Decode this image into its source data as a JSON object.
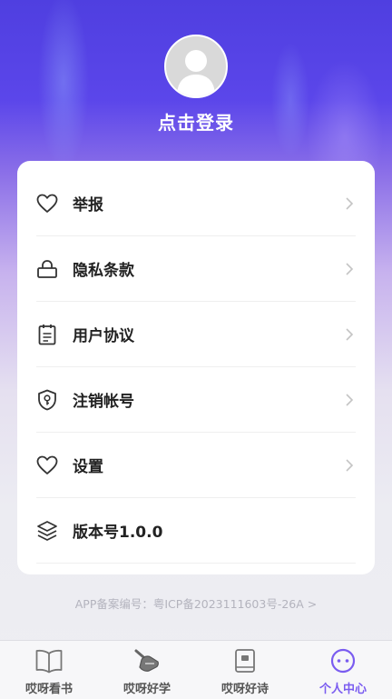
{
  "profile": {
    "login_text": "点击登录"
  },
  "menu": {
    "items": [
      {
        "label": "举报",
        "icon": "heart-icon"
      },
      {
        "label": "隐私条款",
        "icon": "lock-icon"
      },
      {
        "label": "用户协议",
        "icon": "clipboard-icon"
      },
      {
        "label": "注销帐号",
        "icon": "shield-key-icon"
      },
      {
        "label": "设置",
        "icon": "heart-icon"
      },
      {
        "label": "版本号1.0.0",
        "icon": "layers-icon"
      }
    ]
  },
  "footer": {
    "icp": "APP备案编号：粤ICP备2023111603号-26A >"
  },
  "tabbar": {
    "tabs": [
      {
        "label": "哎呀看书",
        "icon": "open-book-icon",
        "active": false
      },
      {
        "label": "哎呀好学",
        "icon": "writing-hand-icon",
        "active": false
      },
      {
        "label": "哎呀好诗",
        "icon": "book-icon",
        "active": false
      },
      {
        "label": "个人中心",
        "icon": "smiley-face-icon",
        "active": true
      }
    ]
  },
  "colors": {
    "accent": "#7a5cf0",
    "header_top": "#4f3fe0",
    "text": "#222222",
    "muted": "#b3b3bd"
  }
}
